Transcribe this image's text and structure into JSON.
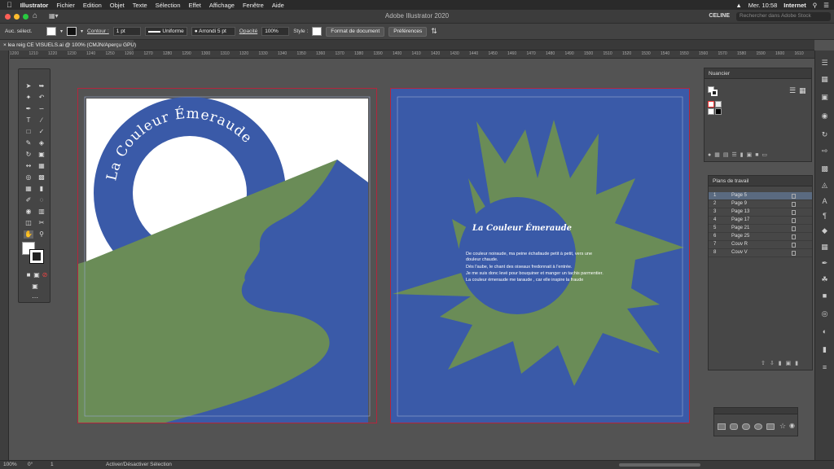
{
  "menubar": {
    "app": "Illustrator",
    "items": [
      "Fichier",
      "Edition",
      "Objet",
      "Texte",
      "Sélection",
      "Effet",
      "Affichage",
      "Fenêtre",
      "Aide"
    ],
    "clock": "Mer. 10:58",
    "network": "Internet"
  },
  "window": {
    "title": "Adobe Illustrator 2020",
    "workspace": "CELINE",
    "search_placeholder": "Rechercher dans Adobe Stock"
  },
  "controlbar": {
    "selection": "Auc. sélect.",
    "contour_label": "Contour :",
    "stroke_weight": "1 pt",
    "stroke_profile": "Uniforme",
    "brush": "Arrondi 5 pt",
    "opacity_label": "Opacité",
    "opacity_value": "100%",
    "style_label": "Style :",
    "doc_format_button": "Format de document",
    "prefs_button": "Préférences"
  },
  "tab": {
    "label": "lea reig CE VISUELS.ai @ 100% (CMJN/Aperçu GPU)"
  },
  "ruler": {
    "ticks": [
      "1200",
      "1210",
      "1220",
      "1230",
      "1240",
      "1250",
      "1260",
      "1270",
      "1280",
      "1290",
      "1300",
      "1310",
      "1320",
      "1330",
      "1340",
      "1350",
      "1360",
      "1370",
      "1380",
      "1390",
      "1400",
      "1410",
      "1420",
      "1430",
      "1440",
      "1450",
      "1460",
      "1470",
      "1480",
      "1490",
      "1500",
      "1510",
      "1520",
      "1530",
      "1540",
      "1550",
      "1560",
      "1570",
      "1580",
      "1590",
      "1600",
      "1610"
    ]
  },
  "artboard1": {
    "arc_title": "La Couleur Émeraude"
  },
  "artboard2": {
    "title": "La Couleur Émeraude",
    "poem": [
      "De couleur noiraude, ma peine échafaude petit à petit, vers une",
      "douleur chaude.",
      "Dès l'aube, le chant des oiseaux fredonnait à l'entrée.",
      "Je me suis donc levé pour bouquiner et manger un tachis parmentier.",
      "La couleur émeraude me taraude , car elle inspire la fraude"
    ]
  },
  "panels": {
    "nuancier_title": "Nuancier",
    "plans_title": "Plans de travail",
    "artboards": [
      {
        "num": "1",
        "name": "Page 5"
      },
      {
        "num": "2",
        "name": "Page 9"
      },
      {
        "num": "3",
        "name": "Page 13"
      },
      {
        "num": "4",
        "name": "Page 17"
      },
      {
        "num": "5",
        "name": "Page 21"
      },
      {
        "num": "6",
        "name": "Page 25"
      },
      {
        "num": "7",
        "name": "Couv R"
      },
      {
        "num": "8",
        "name": "Couv V"
      }
    ]
  },
  "statusbar": {
    "zoom": "100%",
    "angle": "0°",
    "artboard_num": "1",
    "status_text": "Activer/Désactiver Sélection"
  },
  "colors": {
    "blue": "#3a5aa8",
    "green": "#6a8c57",
    "artboard_border": "#b3263d"
  }
}
